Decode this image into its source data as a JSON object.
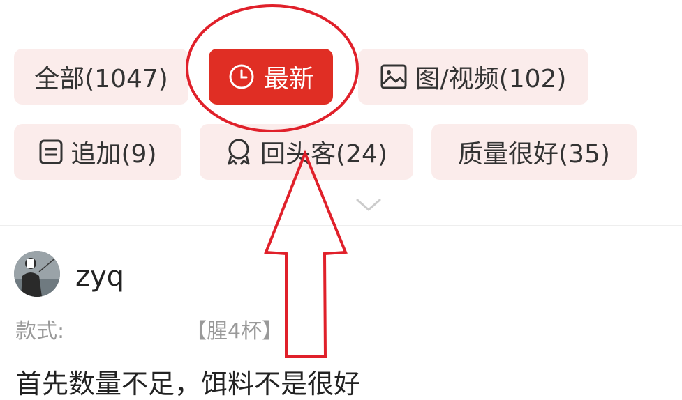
{
  "filters": {
    "all": "全部(1047)",
    "latest": "最新",
    "media": "图/视频(102)",
    "followup": "追加(9)",
    "repeat_buyer": "回头客(24)",
    "good_quality": "质量很好(35)"
  },
  "review": {
    "username": "zyq",
    "spec_label": "款式:",
    "spec_value": "【腥4杯】",
    "text": "首先数量不足，饵料不是很好"
  },
  "icons": {
    "latest": "clock-icon",
    "media": "image-icon",
    "followup": "document-icon",
    "repeat_buyer": "badge-icon",
    "expand": "chevron-down-icon"
  },
  "colors": {
    "accent": "#e02e24",
    "chip_bg": "#fbeceb",
    "annotation": "#e0202a"
  }
}
